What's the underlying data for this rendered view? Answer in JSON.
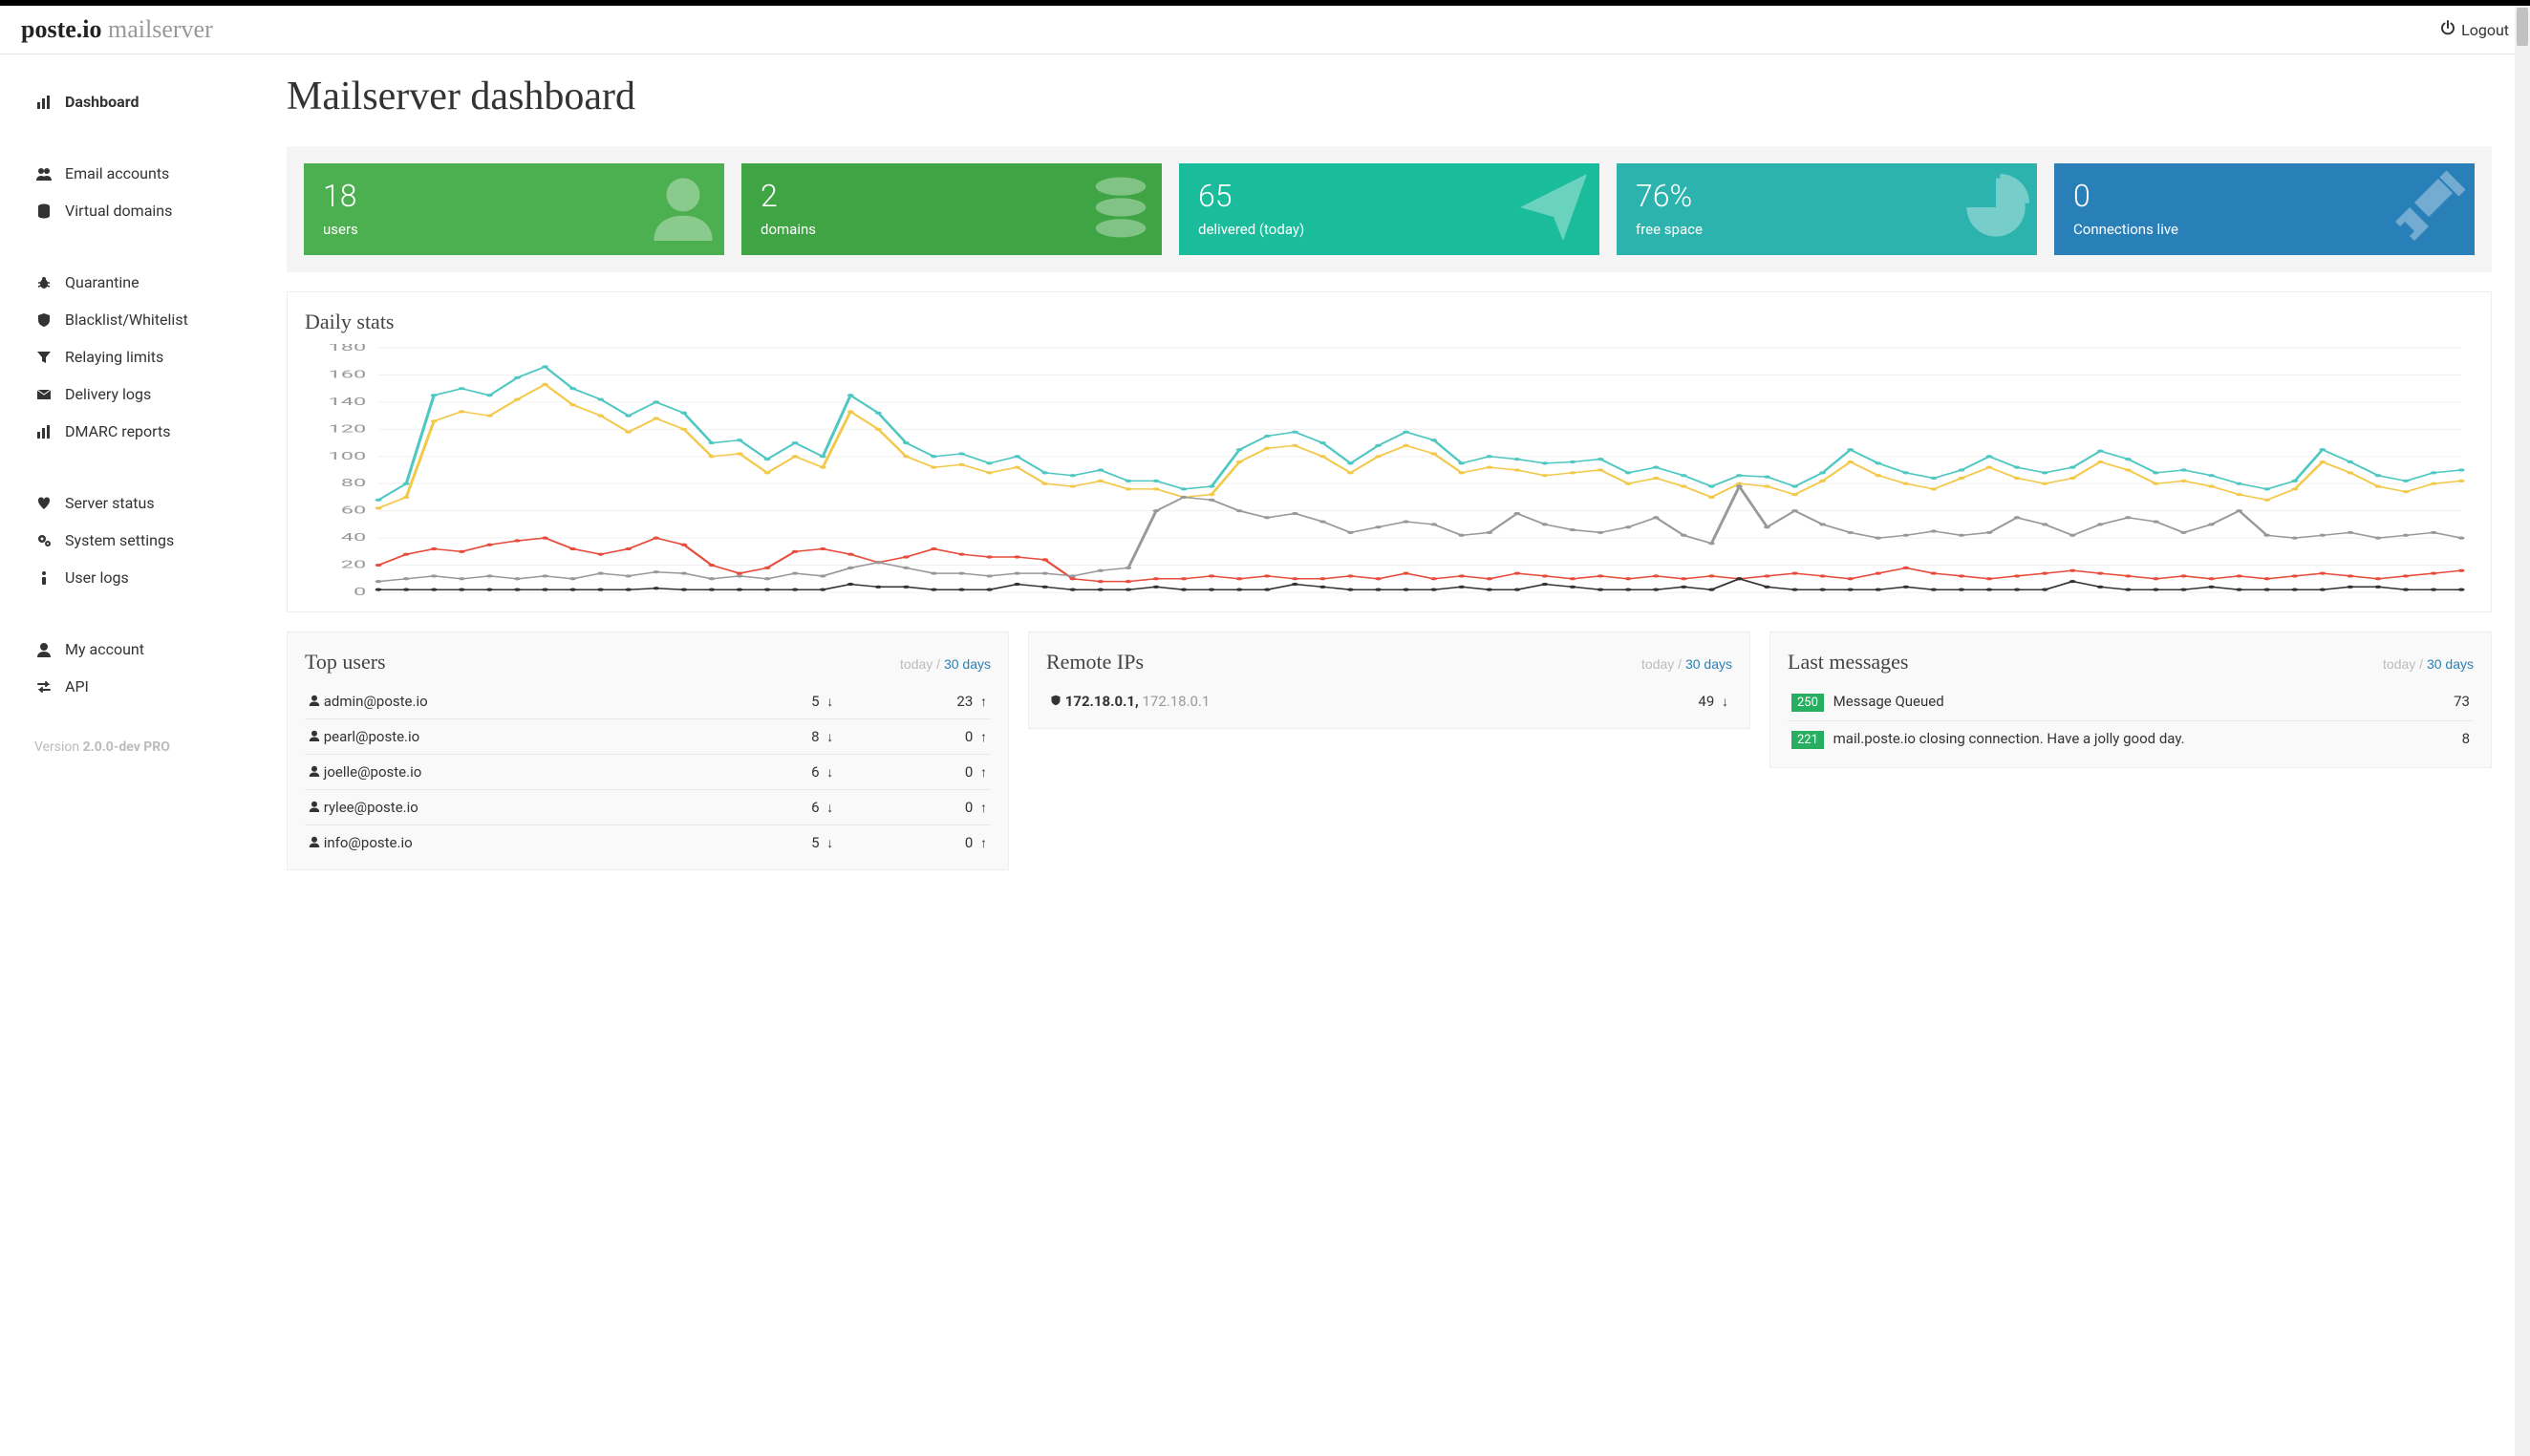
{
  "header": {
    "logo_strong": "poste.io",
    "logo_light": " mailserver",
    "logout": "Logout"
  },
  "sidebar": {
    "groups": [
      [
        {
          "icon": "bar-chart",
          "label": "Dashboard",
          "active": true
        }
      ],
      [
        {
          "icon": "users",
          "label": "Email accounts"
        },
        {
          "icon": "database",
          "label": "Virtual domains"
        }
      ],
      [
        {
          "icon": "bug",
          "label": "Quarantine"
        },
        {
          "icon": "shield",
          "label": "Blacklist/Whitelist"
        },
        {
          "icon": "filter",
          "label": "Relaying limits"
        },
        {
          "icon": "envelope",
          "label": "Delivery logs"
        },
        {
          "icon": "bar-chart",
          "label": "DMARC reports"
        }
      ],
      [
        {
          "icon": "heartbeat",
          "label": "Server status"
        },
        {
          "icon": "cogs",
          "label": "System settings"
        },
        {
          "icon": "info",
          "label": "User logs"
        }
      ],
      [
        {
          "icon": "user",
          "label": "My account"
        },
        {
          "icon": "swap",
          "label": "API"
        }
      ]
    ],
    "version_prefix": "Version ",
    "version": "2.0.0-dev PRO"
  },
  "page": {
    "title": "Mailserver dashboard"
  },
  "tiles": [
    {
      "value": "18",
      "label": "users",
      "color": "t-green1",
      "icon": "user"
    },
    {
      "value": "2",
      "label": "domains",
      "color": "t-green2",
      "icon": "database"
    },
    {
      "value": "65",
      "label": "delivered (today)",
      "color": "t-teal1",
      "icon": "send"
    },
    {
      "value": "76%",
      "label": "free space",
      "color": "t-teal2",
      "icon": "pie"
    },
    {
      "value": "0",
      "label": "Connections live",
      "color": "t-blue",
      "icon": "plug"
    }
  ],
  "daily_stats": {
    "title": "Daily stats"
  },
  "chart_data": {
    "type": "line",
    "ylim": [
      0,
      180
    ],
    "yticks": [
      0,
      20,
      40,
      60,
      80,
      100,
      120,
      140,
      160,
      180
    ],
    "series": [
      {
        "name": "teal",
        "color": "#4fc7c3",
        "values": [
          68,
          80,
          145,
          150,
          145,
          158,
          166,
          150,
          142,
          130,
          140,
          132,
          110,
          112,
          98,
          110,
          100,
          145,
          132,
          110,
          100,
          102,
          95,
          100,
          88,
          86,
          90,
          82,
          82,
          76,
          78,
          105,
          115,
          118,
          110,
          95,
          108,
          118,
          112,
          95,
          100,
          98,
          95,
          96,
          98,
          88,
          92,
          86,
          78,
          86,
          85,
          78,
          88,
          105,
          95,
          88,
          84,
          90,
          100,
          92,
          88,
          92,
          104,
          98,
          88,
          90,
          86,
          80,
          76,
          82,
          105,
          96,
          86,
          82,
          88,
          90
        ]
      },
      {
        "name": "yellow",
        "color": "#f3c94b",
        "values": [
          62,
          70,
          126,
          133,
          130,
          142,
          153,
          138,
          130,
          118,
          128,
          120,
          100,
          102,
          88,
          100,
          92,
          133,
          120,
          100,
          92,
          94,
          88,
          92,
          80,
          78,
          82,
          76,
          76,
          70,
          72,
          96,
          106,
          108,
          100,
          88,
          100,
          108,
          102,
          88,
          92,
          90,
          86,
          88,
          90,
          80,
          84,
          78,
          70,
          80,
          78,
          72,
          82,
          96,
          86,
          80,
          76,
          84,
          92,
          84,
          80,
          84,
          96,
          90,
          80,
          82,
          78,
          72,
          68,
          76,
          96,
          88,
          78,
          74,
          80,
          82
        ]
      },
      {
        "name": "red",
        "color": "#e74c3c",
        "values": [
          20,
          28,
          32,
          30,
          35,
          38,
          40,
          32,
          28,
          32,
          40,
          35,
          20,
          14,
          18,
          30,
          32,
          28,
          22,
          26,
          32,
          28,
          26,
          26,
          24,
          10,
          8,
          8,
          10,
          10,
          12,
          10,
          12,
          10,
          10,
          12,
          10,
          14,
          10,
          12,
          10,
          14,
          12,
          10,
          12,
          10,
          12,
          10,
          12,
          10,
          12,
          14,
          12,
          10,
          14,
          18,
          14,
          12,
          10,
          12,
          14,
          16,
          14,
          12,
          10,
          12,
          10,
          12,
          10,
          12,
          14,
          12,
          10,
          12,
          14,
          16
        ]
      },
      {
        "name": "grey",
        "color": "#999999",
        "values": [
          8,
          10,
          12,
          10,
          12,
          10,
          12,
          10,
          14,
          12,
          15,
          14,
          10,
          12,
          10,
          14,
          12,
          18,
          22,
          18,
          14,
          14,
          12,
          14,
          14,
          12,
          16,
          18,
          60,
          70,
          68,
          60,
          55,
          58,
          52,
          44,
          48,
          52,
          50,
          42,
          44,
          58,
          50,
          46,
          44,
          48,
          55,
          42,
          36,
          78,
          48,
          60,
          50,
          44,
          40,
          42,
          45,
          42,
          44,
          55,
          50,
          42,
          50,
          55,
          52,
          44,
          50,
          60,
          42,
          40,
          42,
          44,
          40,
          42,
          44,
          40
        ]
      },
      {
        "name": "black",
        "color": "#333333",
        "values": [
          2,
          2,
          2,
          2,
          2,
          2,
          2,
          2,
          2,
          2,
          3,
          2,
          2,
          2,
          2,
          2,
          2,
          6,
          4,
          4,
          2,
          2,
          2,
          6,
          4,
          2,
          2,
          2,
          4,
          2,
          2,
          2,
          2,
          6,
          4,
          2,
          2,
          2,
          2,
          4,
          2,
          2,
          6,
          4,
          2,
          2,
          2,
          4,
          2,
          10,
          4,
          2,
          2,
          2,
          2,
          4,
          2,
          2,
          2,
          2,
          2,
          8,
          4,
          2,
          2,
          2,
          4,
          2,
          2,
          2,
          2,
          4,
          4,
          2,
          2,
          2
        ]
      }
    ]
  },
  "top_users": {
    "title": "Top users",
    "range_today": "today",
    "range_30": "30 days",
    "rows": [
      {
        "user": "admin@poste.io",
        "in": "5",
        "out": "23"
      },
      {
        "user": "pearl@poste.io",
        "in": "8",
        "out": "0"
      },
      {
        "user": "joelle@poste.io",
        "in": "6",
        "out": "0"
      },
      {
        "user": "rylee@poste.io",
        "in": "6",
        "out": "0"
      },
      {
        "user": "info@poste.io",
        "in": "5",
        "out": "0"
      }
    ]
  },
  "remote_ips": {
    "title": "Remote IPs",
    "range_today": "today",
    "range_30": "30 days",
    "rows": [
      {
        "ip_bold": "172.18.0.1,",
        "ip_grey": "172.18.0.1",
        "count": "49"
      }
    ]
  },
  "last_messages": {
    "title": "Last messages",
    "range_today": "today",
    "range_30": "30 days",
    "rows": [
      {
        "code": "250",
        "text": "Message Queued",
        "count": "73"
      },
      {
        "code": "221",
        "text": "mail.poste.io closing connection. Have a jolly good day.",
        "count": "8"
      }
    ]
  }
}
